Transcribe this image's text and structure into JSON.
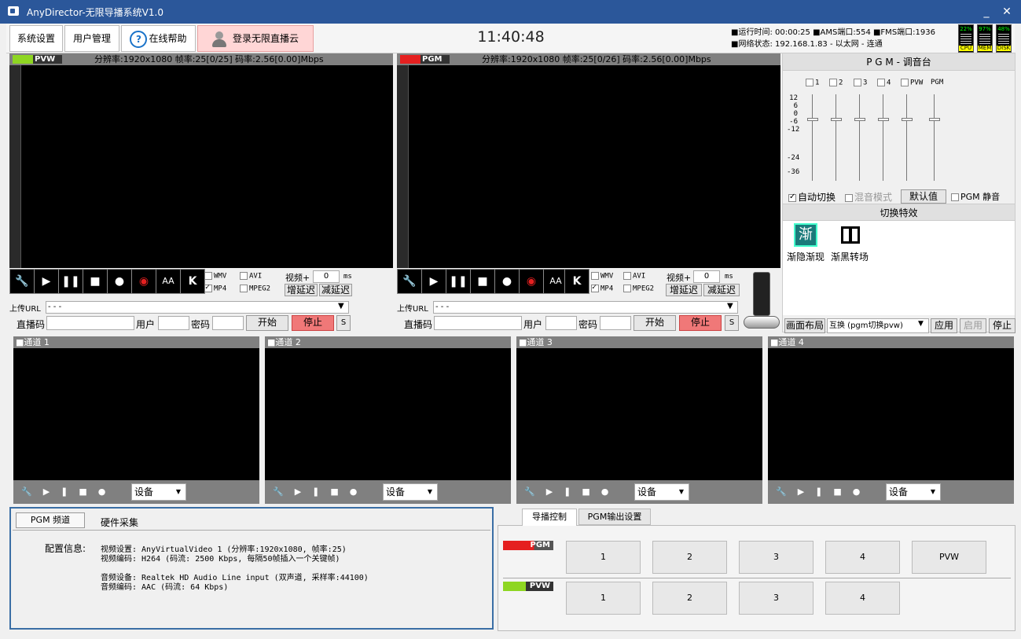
{
  "window": {
    "title": "AnyDirector-无限导播系统V1.0",
    "minimize": "_",
    "close": "✕"
  },
  "toolbar": {
    "system_settings": "系统设置",
    "user_mgmt": "用户管理",
    "help_icon": "?",
    "help": "在线帮助",
    "login": "登录无限直播云"
  },
  "clock": "11:40:48",
  "status": {
    "line1": "■运行时间: 00:00:25  ■AMS端口:554  ■FMS端口:1936",
    "line2": "■网络状态: 192.168.1.83 - 以太网 - 连通"
  },
  "meters": [
    {
      "value": "22%",
      "label": "CPU"
    },
    {
      "value": "97%",
      "label": "MEM"
    },
    {
      "value": "48%",
      "label": "DISK"
    }
  ],
  "pvw": {
    "tag": "PVW",
    "info": "分辨率:1920x1080 帧率:25[0/25] 码率:2.56[0.00]Mbps"
  },
  "pgm": {
    "tag": "PGM",
    "info": "分辨率:1920x1080 帧率:25[0/26] 码率:2.56[0.00]Mbps"
  },
  "controls": {
    "wmv": "WMV",
    "avi": "AVI",
    "mp4": "MP4",
    "mpeg2": "MPEG2",
    "video_plus": "视频+",
    "delay_value": "0",
    "ms": "ms",
    "inc_delay": "增延迟",
    "dec_delay": "减延迟",
    "upload_url": "上传URL",
    "url_value": "- - -",
    "stream_code": "直播码",
    "user": "用户",
    "password": "密码",
    "start": "开始",
    "stop": "停止",
    "s": "S",
    "aa": "AA",
    "k": "K"
  },
  "mixer": {
    "title": "P G M - 调音台",
    "channels": [
      "1",
      "2",
      "3",
      "4",
      "PVW",
      "PGM"
    ],
    "scale": [
      "12",
      "6",
      "0",
      "-6",
      "-12",
      "-24",
      "-36"
    ],
    "auto_switch": "自动切换",
    "mix_mode": "混音模式",
    "default": "默认值",
    "pgm_mute": "PGM 静音",
    "effects_title": "切换特效",
    "effect1_glyph": "渐",
    "effect1": "渐隐渐现",
    "effect2": "渐黑转场",
    "layout": "画面布局",
    "swap": "互换 (pgm切换pvw)",
    "apply": "应用",
    "enable": "启用",
    "stop": "停止"
  },
  "channels": [
    {
      "label": "■通道 1"
    },
    {
      "label": "■通道 2"
    },
    {
      "label": "■通道 3"
    },
    {
      "label": "■通道 4"
    }
  ],
  "channel_ctl": {
    "device": "设备"
  },
  "bottom_left": {
    "tab1": "PGM 频道",
    "tab2": "硬件采集",
    "config_label": "配置信息:",
    "video_settings": "视频设置: AnyVirtualVideo 1 (分辨率:1920x1080, 帧率:25)",
    "video_codec": "视频编码: H264 (码流: 2500 Kbps, 每隔50帧插入一个关键帧)",
    "audio_device": "音频设备: Realtek HD Audio Line input (双声道, 采样率:44100)",
    "audio_codec": "音频编码: AAC (码流: 64 Kbps)"
  },
  "bottom_right": {
    "tab1": "导播控制",
    "tab2": "PGM输出设置",
    "pgm_label": "PGM",
    "pvw_label": "PVW",
    "pgm_buttons": [
      "1",
      "2",
      "3",
      "4",
      "PVW"
    ],
    "pvw_buttons": [
      "1",
      "2",
      "3",
      "4"
    ]
  },
  "colors": {
    "titlebar": "#2b579a",
    "pgm_red": "#e52020",
    "pvw_green": "#8ed622",
    "stop_red": "#f07878"
  }
}
